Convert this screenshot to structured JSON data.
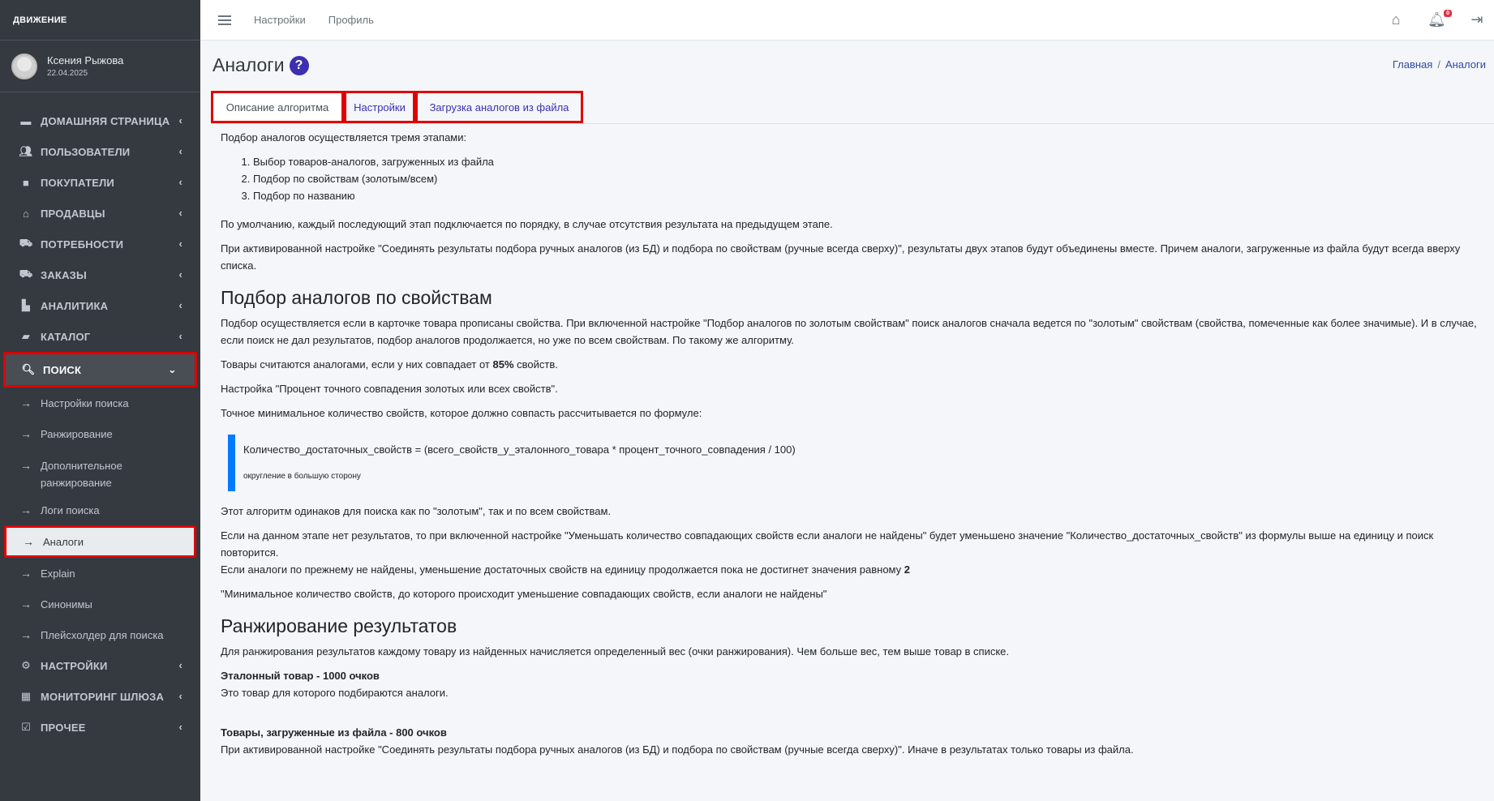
{
  "app": {
    "logo": "ДВИЖЕНИЕ"
  },
  "user": {
    "name": "Ксения Рыжова",
    "date": "22.04.2025"
  },
  "topbar": {
    "links": [
      "Настройки",
      "Профиль"
    ],
    "notification_count": "0"
  },
  "sidebar": {
    "items": [
      {
        "label": "ДОМАШНЯЯ СТРАНИЦА",
        "icon": "home-card-icon"
      },
      {
        "label": "ПОЛЬЗОВАТЕЛИ",
        "icon": "users-icon"
      },
      {
        "label": "ПОКУПАТЕЛИ",
        "icon": "briefcase-icon"
      },
      {
        "label": "ПРОДАВЦЫ",
        "icon": "bank-icon"
      },
      {
        "label": "ПОТРЕБНОСТИ",
        "icon": "cart-plus-icon"
      },
      {
        "label": "ЗАКАЗЫ",
        "icon": "cart-icon"
      },
      {
        "label": "АНАЛИТИКА",
        "icon": "chart-icon"
      },
      {
        "label": "КАТАЛОГ",
        "icon": "folder-icon"
      },
      {
        "label": "ПОИСК",
        "icon": "search-icon"
      }
    ],
    "sub_items": [
      "Настройки поиска",
      "Ранжирование",
      "Дополнительное ранжирование",
      "Логи поиска",
      "Аналоги",
      "Explain",
      "Синонимы",
      "Плейсхолдер для поиска"
    ],
    "bottom_items": [
      {
        "label": "НАСТРОЙКИ",
        "icon": "cogs-icon"
      },
      {
        "label": "МОНИТОРИНГ ШЛЮЗА",
        "icon": "table-icon"
      },
      {
        "label": "ПРОЧЕЕ",
        "icon": "checkbox-icon"
      }
    ]
  },
  "page": {
    "title": "Аналоги",
    "breadcrumb": [
      "Главная",
      "Аналоги"
    ],
    "tabs": [
      "Описание алгоритма",
      "Настройки",
      "Загрузка аналогов из файла"
    ]
  },
  "article": {
    "intro": "Подбор аналогов осуществляется тремя этапами:",
    "steps": [
      "Выбор товаров-аналогов, загруженных из файла",
      "Подбор по свойствам (золотым/всем)",
      "Подбор по названию"
    ],
    "p1": "По умолчанию, каждый последующий этап подключается по порядку, в случае отсутствия результата на предыдущем этапе.",
    "p2": "При активированной настройке  \"Соединять результаты подбора ручных аналогов (из БД) и подбора по свойствам (ручные всегда сверху)\", результаты двух этапов будут объединены вместе. Причем аналоги, загруженные из файла будут всегда вверху списка.",
    "h1": "Подбор аналогов по свойствам",
    "p3": "Подбор осуществляется если в карточке товара прописаны свойства. При включенной настройке  \"Подбор аналогов по золотым свойствам\" поиск аналогов сначала ведется по \"золотым\" свойствам (свойства, помеченные как более значимые). И в случае, если поиск не дал результатов, подбор аналогов продолжается, но уже по всем свойствам. По такому же алгоритму.",
    "p4_pre": "Товары считаются аналогами, если у них совпадает от ",
    "p4_bold": "85%",
    "p4_post": " свойств.",
    "p5": "Настройка  \"Процент точного совпадения золотых или всех свойств\".",
    "p6": "Точное минимальное количество свойств, которое должно совпасть рассчитывается по формуле:",
    "formula": "Количество_достаточных_свойств = (всего_свойств_у_эталонного_товара * процент_точного_совпадения / 100)",
    "formula_note": "округление в большую сторону",
    "p7": "Этот алгоритм одинаков для поиска как по \"золотым\", так и по всем свойствам.",
    "p8a": "Если на данном этапе нет результатов, то при включенной настройке  \"Уменьшать количество совпадающих свойств если аналоги не найдены\" будет уменьшено значение \"Количество_достаточных_свойств\" из формулы выше на единицу и поиск повторится.",
    "p8b_pre": "Если аналоги по прежнему не найдены, уменьшение достаточных свойств на единицу продолжается пока не достигнет значения равному ",
    "p8b_bold": "2",
    "p9": " \"Минимальное количество свойств, до которого происходит уменьшение совпадающих свойств, если аналоги не найдены\"",
    "h2": "Ранжирование результатов",
    "p10": "Для ранжирования результатов каждому товару из найденных начисляется определенный вес (очки ранжирования). Чем больше вес, тем выше товар в списке.",
    "r1_title": "Эталонный товар - 1000 очков",
    "r1_text": "Это товар для которого подбираются аналоги.",
    "r2_title": "Товары, загруженные из файла - 800 очков",
    "r2_text": "При активированной настройке  \"Соединять результаты подбора ручных аналогов (из БД) и подбора по свойствам (ручные всегда сверху)\". Иначе в результатах только товары из файла."
  }
}
